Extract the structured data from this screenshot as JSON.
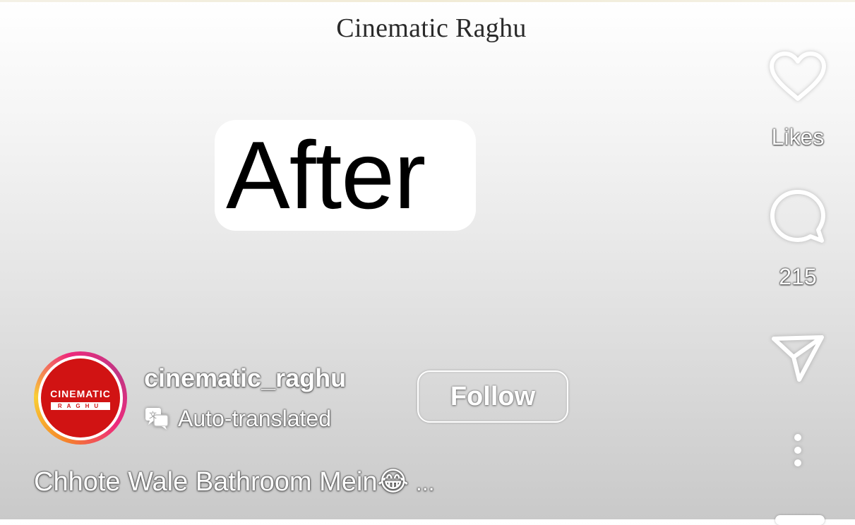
{
  "video": {
    "watermark": "Cinematic Raghu",
    "overlay_text": "After"
  },
  "actions": {
    "like_label": "Likes",
    "comment_count": "215",
    "like_icon": "heart-icon",
    "comment_icon": "comment-bubble-icon",
    "share_icon": "paper-plane-icon",
    "more_icon": "vertical-dots-icon"
  },
  "author": {
    "username": "cinematic_raghu",
    "avatar_text": "CINEMATIC",
    "avatar_subtext": "RAGHU",
    "translation_note": "Auto-translated",
    "follow_label": "Follow"
  },
  "caption": {
    "text": "Chhote Wale Bathroom Mein😂",
    "more": "..."
  },
  "colors": {
    "avatar_red": "#d11313",
    "text_white": "#ffffff"
  }
}
